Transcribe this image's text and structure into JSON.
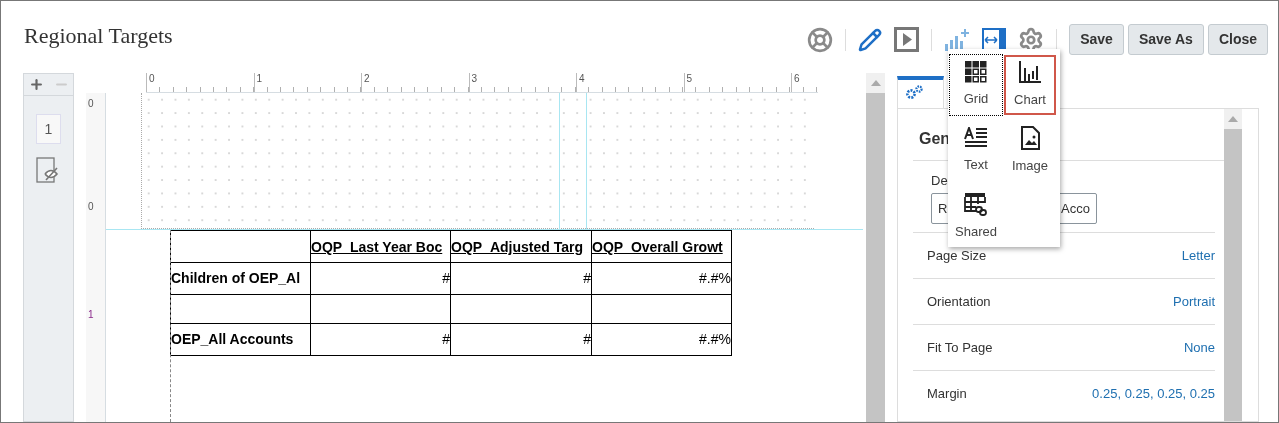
{
  "title": "Regional Targets",
  "toolbar": {
    "icons": [
      {
        "kind": "help"
      },
      {
        "kind": "edit"
      },
      {
        "kind": "preview"
      },
      {
        "kind": "insert"
      },
      {
        "kind": "fit"
      },
      {
        "kind": "settings"
      }
    ],
    "buttons": [
      "Save",
      "Save As",
      "Close"
    ]
  },
  "page_panel": {
    "page_number": "1"
  },
  "rulers": {
    "horizontal": [
      "0",
      "1",
      "2",
      "3",
      "4",
      "5",
      "6"
    ],
    "vertical": [
      "0",
      "0",
      "1"
    ]
  },
  "table": {
    "columns": [
      "",
      "OQP_Last Year Boc",
      "OQP_Adjusted Targ",
      "OQP_Overall Growt"
    ],
    "rows": [
      [
        "Children of OEP_Al",
        "#",
        "#",
        "#.#%"
      ],
      [
        "",
        "",
        "",
        ""
      ],
      [
        "OEP_All Accounts",
        "#",
        "#",
        "#.#%"
      ]
    ]
  },
  "properties": {
    "heading": "Gen",
    "description_label": "De",
    "description_value_start": "R",
    "description_value_end": "Acco",
    "rows": [
      {
        "label": "Page Size",
        "value": "Letter"
      },
      {
        "label": "Orientation",
        "value": "Portrait"
      },
      {
        "label": "Fit To Page",
        "value": "None"
      },
      {
        "label": "Margin",
        "value": "0.25, 0.25, 0.25, 0.25"
      }
    ]
  },
  "insert_menu": [
    {
      "label": "Grid",
      "kind": "grid",
      "selected": false,
      "focused": true
    },
    {
      "label": "Chart",
      "kind": "chart",
      "selected": true,
      "focused": false
    },
    {
      "label": "Text",
      "kind": "text",
      "selected": false,
      "focused": false
    },
    {
      "label": "Image",
      "kind": "image",
      "selected": false,
      "focused": false
    },
    {
      "label": "Shared",
      "kind": "shared",
      "selected": false,
      "focused": false
    }
  ]
}
